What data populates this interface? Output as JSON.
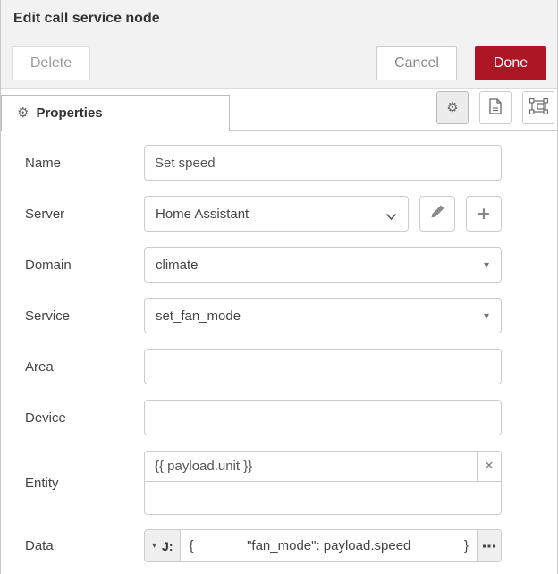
{
  "window": {
    "title": "Edit call service node"
  },
  "toolbar": {
    "delete": "Delete",
    "cancel": "Cancel",
    "done": "Done"
  },
  "tabs": {
    "properties": "Properties"
  },
  "form": {
    "name": {
      "label": "Name",
      "value": "Set speed"
    },
    "server": {
      "label": "Server",
      "value": "Home Assistant"
    },
    "domain": {
      "label": "Domain",
      "value": "climate"
    },
    "service": {
      "label": "Service",
      "value": "set_fan_mode"
    },
    "area": {
      "label": "Area",
      "value": ""
    },
    "device": {
      "label": "Device",
      "value": ""
    },
    "entity": {
      "label": "Entity",
      "value": "{{ payload.unit }}",
      "extra_value": ""
    },
    "data": {
      "label": "Data",
      "type_label": "J:",
      "expr_open": "{",
      "expr_body": "\"fan_mode\": payload.speed",
      "expr_close": "}"
    }
  },
  "icons": {
    "gear": "⚙",
    "caret_down": "▾",
    "triangle_down": "▾",
    "close": "✕",
    "plus": "+",
    "ellipsis": "●●●"
  },
  "colors": {
    "accent_red": "#ad1625",
    "panel_bg": "#f2f2f2",
    "border": "#cccccc"
  }
}
